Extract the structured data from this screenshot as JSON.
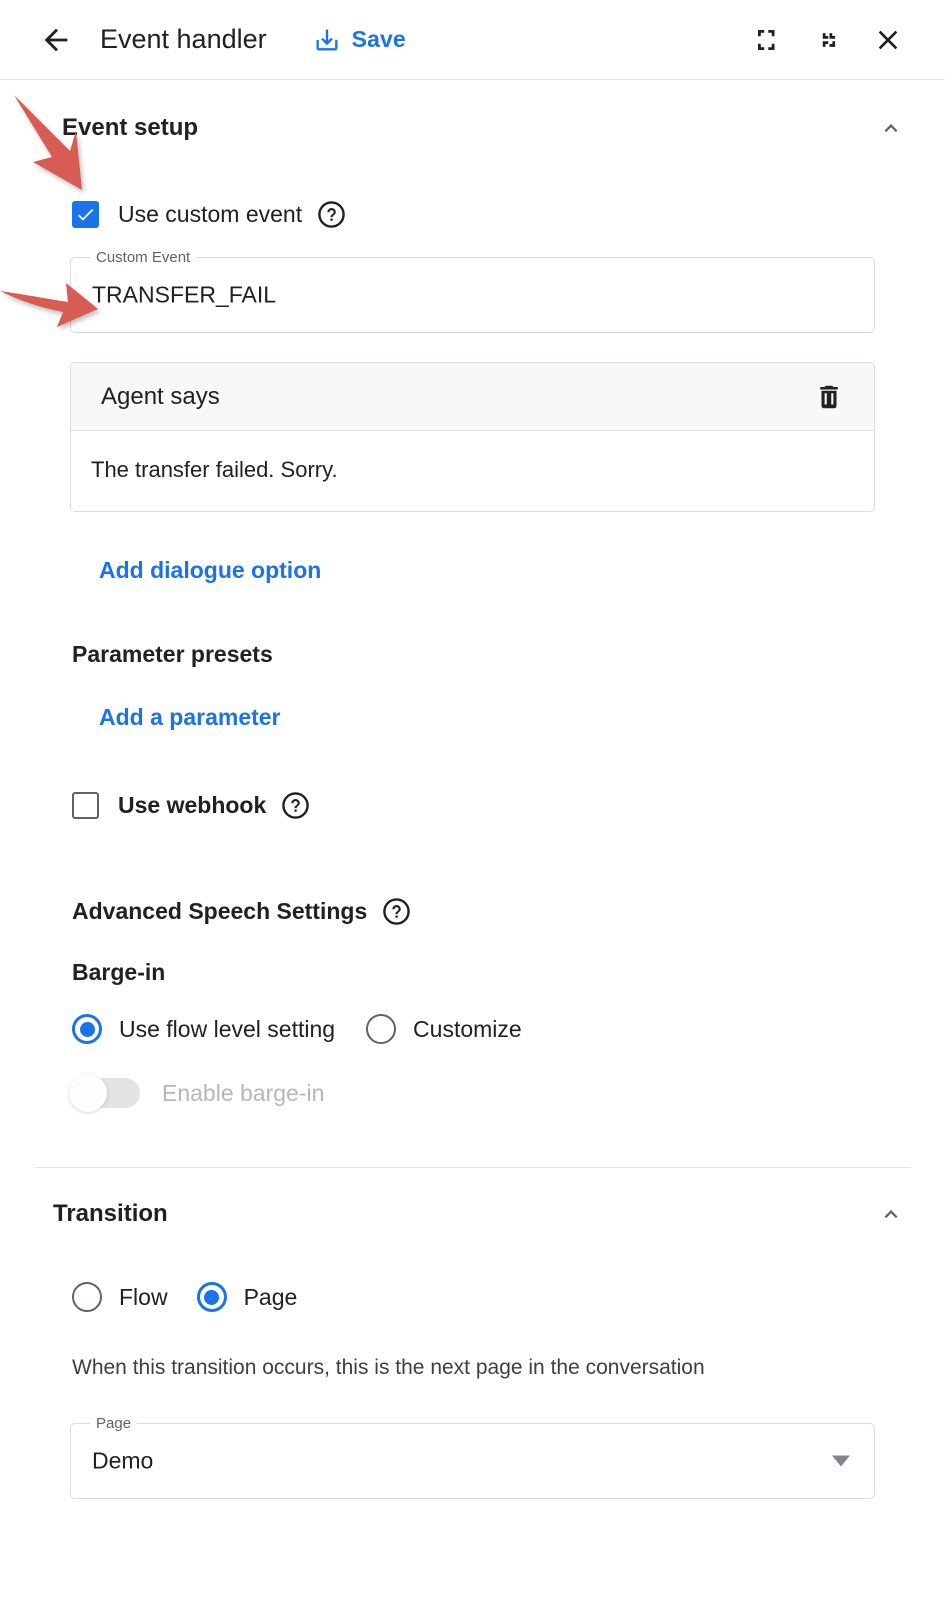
{
  "header": {
    "back_icon": "arrow-back-icon",
    "title": "Event handler",
    "save_icon": "save-alt-icon",
    "save_label": "Save",
    "fullscreen_icon": "fullscreen-icon",
    "collapse_icon": "fullscreen-exit-icon",
    "close_icon": "close-icon"
  },
  "event_setup": {
    "title": "Event setup",
    "collapse_icon": "chevron-up-icon",
    "use_custom_event": {
      "label": "Use custom event",
      "checked": true,
      "help_icon": "help-outline-icon"
    },
    "custom_event_field": {
      "legend": "Custom Event",
      "value": "TRANSFER_FAIL"
    },
    "agent_says": {
      "title": "Agent says",
      "delete_icon": "trash-icon",
      "message": "The transfer failed. Sorry."
    },
    "add_dialogue_option": "Add dialogue option",
    "parameter_presets_title": "Parameter presets",
    "add_a_parameter": "Add a parameter",
    "use_webhook": {
      "label": "Use webhook",
      "checked": false,
      "help_icon": "help-outline-icon"
    },
    "advanced_speech": {
      "title": "Advanced Speech Settings",
      "help_icon": "help-outline-icon",
      "barge_in_title": "Barge-in",
      "options": [
        {
          "label": "Use flow level setting",
          "selected": true
        },
        {
          "label": "Customize",
          "selected": false
        }
      ],
      "enable_barge_in": {
        "label": "Enable barge-in",
        "on": false,
        "disabled": true
      }
    }
  },
  "transition": {
    "title": "Transition",
    "collapse_icon": "chevron-up-icon",
    "target_options": [
      {
        "label": "Flow",
        "selected": false
      },
      {
        "label": "Page",
        "selected": true
      }
    ],
    "helper_text": "When this transition occurs, this is the next page in the conversation",
    "page_field": {
      "legend": "Page",
      "value": "Demo",
      "dropdown_icon": "dropdown-arrow-icon"
    }
  },
  "annotations": {
    "arrow_color": "#d75c52",
    "arrows": [
      {
        "name": "arrow-to-use-custom-event-checkbox",
        "points_to": "use-custom-event-checkbox"
      },
      {
        "name": "arrow-to-custom-event-value",
        "points_to": "custom-event-input"
      }
    ]
  }
}
